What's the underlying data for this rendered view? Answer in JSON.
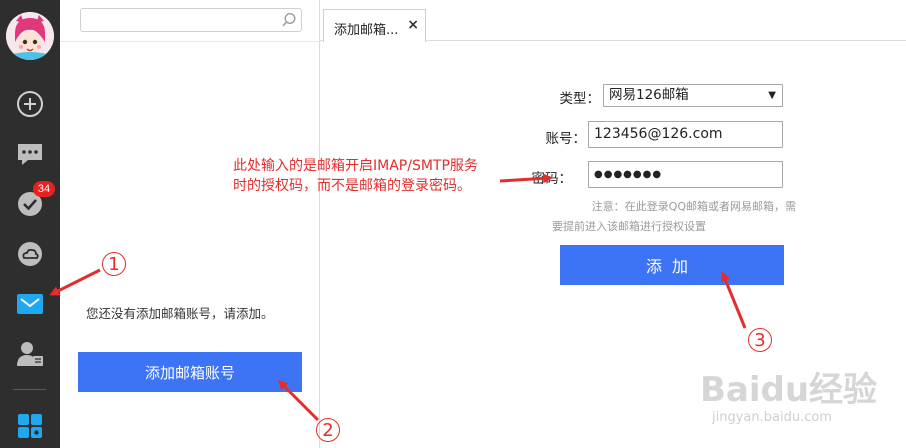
{
  "sidebar": {
    "badge_count": "34"
  },
  "middle_panel": {
    "search_placeholder": "",
    "empty_message": "您还没有添加邮箱账号，请添加。",
    "add_account_label": "添加邮箱账号"
  },
  "tab": {
    "label": "添加邮箱...",
    "close": "×"
  },
  "form": {
    "type_label": "类型：",
    "type_value": "网易126邮箱",
    "type_arrow": "▼",
    "account_label": "账号：",
    "account_value": "123456@126.com",
    "password_label": "密码：",
    "password_value": "●●●●●●●",
    "note_line1": "注意：在此登录QQ邮箱或者网易邮箱，需",
    "note_line2": "要提前进入该邮箱进行授权设置",
    "submit_label": "添加"
  },
  "annotations": {
    "callout_line1": "此处输入的是邮箱开启IMAP/SMTP服务",
    "callout_line2": "时的授权码，而不是邮箱的登录密码。",
    "step1": "1",
    "step2": "2",
    "step3": "3"
  },
  "watermark": {
    "logo": "Baidu经验",
    "url": "jingyan.baidu.com"
  },
  "colors": {
    "rail": "#2e2e2e",
    "accent_blue": "#3d74f5",
    "mail_icon": "#1fa8f0",
    "annotation_red": "#e42d2d"
  }
}
